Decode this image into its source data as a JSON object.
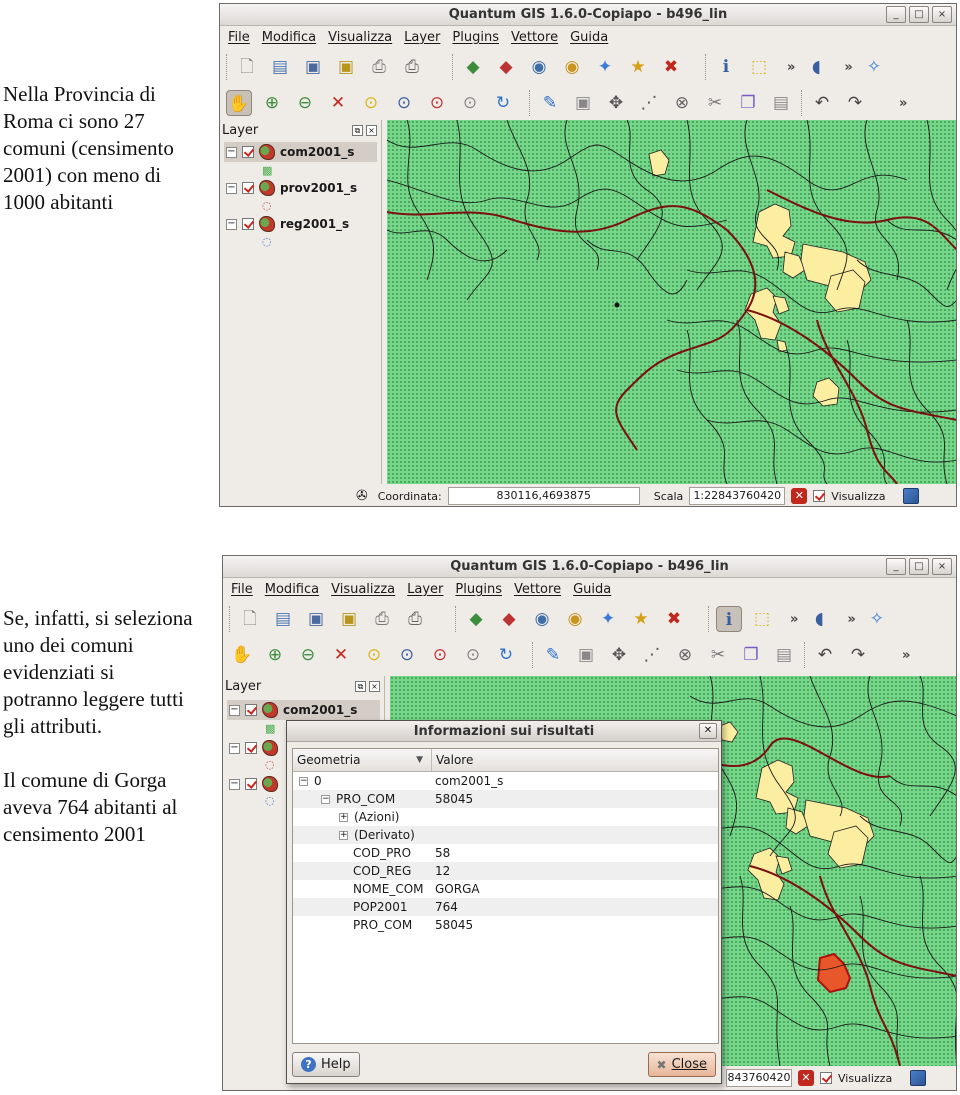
{
  "captions": {
    "top": [
      "Nella Provincia di",
      "Roma ci sono 27",
      "comuni (censimento",
      "2001) con meno di",
      "1000 abitanti"
    ],
    "bottom_a": [
      "Se, infatti, si seleziona",
      "uno dei comuni",
      "evidenziati si",
      "potranno leggere tutti",
      "gli attributi."
    ],
    "bottom_b": [
      "Il comune di Gorga",
      "aveva 764 abitanti al",
      "censimento 2001"
    ]
  },
  "app": {
    "title": "Quantum GIS 1.6.0-Copiapo - b496_lin",
    "menu": [
      "File",
      "Modifica",
      "Visualizza",
      "Layer",
      "Plugins",
      "Vettore",
      "Guida"
    ],
    "window_buttons": [
      "_",
      "□",
      "×"
    ],
    "overflow": "»",
    "toolbar_file_icons": [
      "new-project-icon",
      "open-project-icon",
      "save-project-icon",
      "save-as-icon",
      "print-composer-icon",
      "print-icon"
    ],
    "toolbar_layer_icons": [
      "add-vector-layer-icon",
      "add-raster-layer-icon",
      "add-postgis-icon",
      "add-spatialite-icon",
      "add-wms-icon",
      "new-vector-layer-icon",
      "remove-layer-icon"
    ],
    "toolbar_nav_icons": [
      "pan-icon",
      "zoom-in-icon",
      "zoom-out-icon",
      "zoom-full-icon",
      "zoom-selection-icon",
      "zoom-layer-icon",
      "zoom-last-icon",
      "zoom-next-icon",
      "refresh-icon"
    ],
    "toolbar_edit_icons": [
      "toggle-edit-icon",
      "save-edits-icon",
      "move-feature-icon",
      "node-tool-icon",
      "delete-selected-icon",
      "cut-icon",
      "copy-icon",
      "paste-icon",
      "undo-icon",
      "redo-icon"
    ]
  },
  "layers_panel": {
    "title": "Layer",
    "items": [
      {
        "name": "com2001_s",
        "selected": true,
        "symbol_color": "#4caf50"
      },
      {
        "name": "prov2001_s",
        "selected": false,
        "symbol_color": "#d23b3b"
      },
      {
        "name": "reg2001_s",
        "selected": false,
        "symbol_color": "#3b6fd2"
      }
    ],
    "collapse": "−"
  },
  "statusbar": {
    "coord_label": "Coordinata:",
    "coord_value": "830116,4693875",
    "scale_label": "Scala",
    "scale_value": "1:22843760420",
    "scale_value_partial": "843760420",
    "render_label": "Visualizza"
  },
  "info_dialog": {
    "title": "Informazioni sui risultati",
    "col_geometry": "Geometria",
    "col_value": "Valore",
    "sort_arrow": "▼",
    "rows": [
      {
        "indent": 0,
        "expander": "−",
        "key": "0",
        "value": "com2001_s"
      },
      {
        "indent": 1,
        "expander": "−",
        "key": "PRO_COM",
        "value": "58045"
      },
      {
        "indent": 2,
        "expander": "+",
        "key": "(Azioni)",
        "value": ""
      },
      {
        "indent": 2,
        "expander": "+",
        "key": "(Derivato)",
        "value": ""
      },
      {
        "indent": 3,
        "expander": "",
        "key": "COD_PRO",
        "value": "58"
      },
      {
        "indent": 3,
        "expander": "",
        "key": "COD_REG",
        "value": "12"
      },
      {
        "indent": 3,
        "expander": "",
        "key": "NOME_COM",
        "value": "GORGA"
      },
      {
        "indent": 3,
        "expander": "",
        "key": "POP2001",
        "value": "764"
      },
      {
        "indent": 3,
        "expander": "",
        "key": "PRO_COM",
        "value": "58045"
      }
    ],
    "help_label": "Help",
    "close_label": "Close"
  },
  "colors": {
    "map_fill": "#76d68a",
    "highlight_fill": "#fbeea0",
    "selected_fill": "#e8572a",
    "province_border": "#7a1010",
    "commune_border": "#1b1b1b"
  }
}
